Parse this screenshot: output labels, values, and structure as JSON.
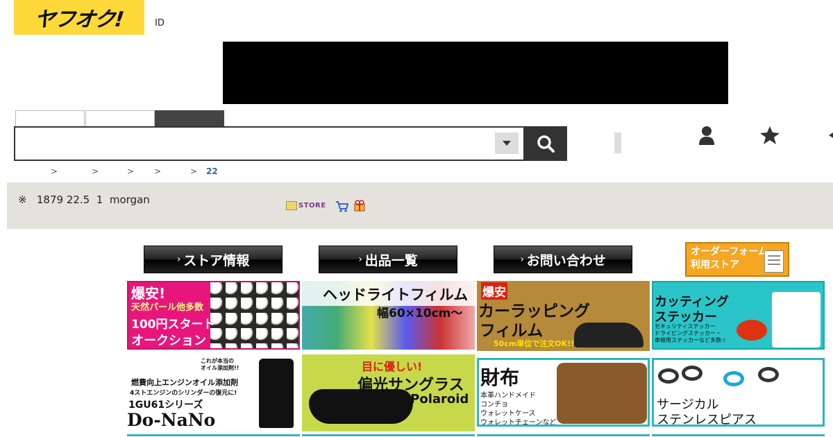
{
  "header": {
    "logo_text": "ヤフオク!",
    "id_label": "ID"
  },
  "search": {
    "value": "",
    "placeholder": ""
  },
  "breadcrumb": {
    "sep1": ">",
    "sep2": ">",
    "sep3": ">",
    "sep4": ">",
    "sep5": ">",
    "last": "22"
  },
  "store_bar": {
    "text": "※   1879 22.5  1  morgan",
    "store_badge": "STORE"
  },
  "nav": {
    "store_info": "ストア情報",
    "listing": "出品一覧",
    "contact": "お問い合わせ",
    "order_form_line1": "オーダーフォーム",
    "order_form_line2": "利用ストア"
  },
  "tiles": {
    "pearl": {
      "l1": "爆安!",
      "l2": "天然パール他多数",
      "l3": "100円スタート",
      "l4": "オークション"
    },
    "headlight": {
      "l1": "ヘッドライトフィルム",
      "l2": "幅60×10cm〜"
    },
    "wrap": {
      "l1": "爆安",
      "l2": "カーラッピング",
      "l3": "フィルム",
      "l4": "50cm単位で注文OK!!"
    },
    "sticker": {
      "l1": "カッティング",
      "l2": "ステッカー",
      "l3": "セキュリティステッカー",
      "l4": "ドライビングステッカー・",
      "l5": "車検用ステッカーなど多数☆"
    },
    "oil": {
      "l1": "これが本当の",
      "l2": "オイル添加剤!!",
      "l3": "燃費向上エンジンオイル添加剤",
      "l4": "4ストエンジンのシリンダーの復元に!",
      "l5": "1GU61シリーズ",
      "l6": "Do-NaNo"
    },
    "sunglass": {
      "l1": "目に優しい!",
      "l2": "偏光サングラス",
      "l3": "❖Polaroid"
    },
    "wallet": {
      "l1": "財布",
      "l2": "本革ハンドメイド",
      "l3": "コンチョ",
      "l4": "ウォレットケース",
      "l5": "ウォレットチェーンなど"
    },
    "piercing": {
      "l1": "サージカル",
      "l2": "ステンレスピアス"
    }
  },
  "colors": {
    "logo_yellow": "#ffd93a",
    "info_bar_bg": "#e4e2dc",
    "tile_border_teal": "#2bb6c2",
    "order_orange": "#f5a623"
  },
  "icons": [
    "search-icon",
    "dropdown-arrow-icon",
    "user-icon",
    "star-icon",
    "arrow-left-icon",
    "cart-icon",
    "gift-icon",
    "store-icon"
  ]
}
